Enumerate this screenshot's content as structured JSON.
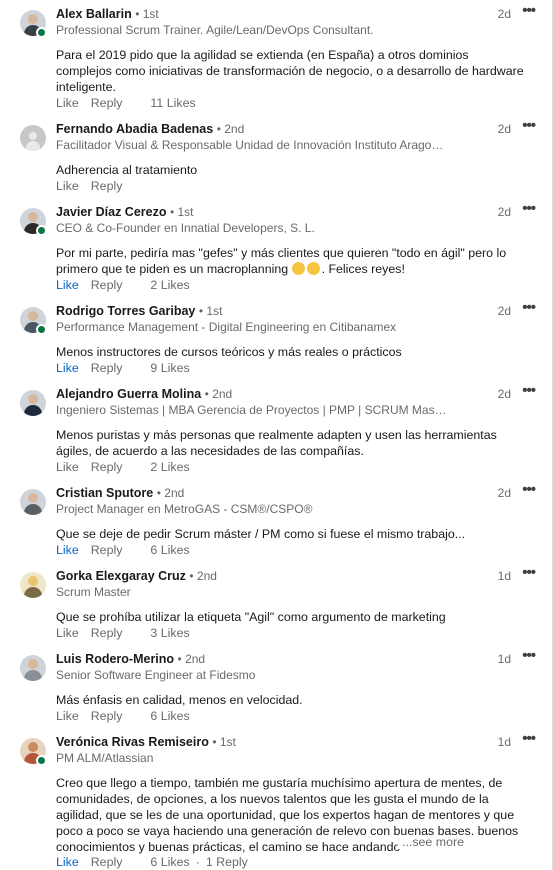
{
  "icons": {
    "more": "more-horizontal-icon",
    "avatar_placeholder": "person-icon",
    "emoji": "laughing-emoji-icon"
  },
  "colors": {
    "link_blue": "#0a66c2",
    "online_green": "#057642",
    "muted": "#666666"
  },
  "comments": [
    {
      "name": "Alex Ballarin",
      "degree": "• 1st",
      "headline": "Professional Scrum Trainer. Agile/Lean/DevOps Consultant.",
      "time": "2d",
      "text": "Para el 2019 pido que la agilidad se extienda (en España) a otros dominios complejos como iniciativas de transformación de negocio, o a desarrollo de hardware inteligente.",
      "like": "Like",
      "reply": "Reply",
      "likes": "11 Likes",
      "online": true,
      "liked": false
    },
    {
      "name": "Fernando Abadia Badenas",
      "degree": "• 2nd",
      "headline": "Facilitador Visual & Responsable Unidad de Innovación Instituto Aragonés de Ciencias de la Salud",
      "time": "2d",
      "text": "Adherencia al tratamiento",
      "like": "Like",
      "reply": "Reply",
      "likes": "",
      "online": false,
      "liked": false,
      "ghost": true
    },
    {
      "name": "Javier Díaz Cerezo",
      "degree": "• 1st",
      "headline": "CEO & Co-Founder en Innatial Developers, S. L.",
      "time": "2d",
      "text": "Por mi parte, pediría mas \"gefes\" y más clientes que quieren \"todo en ágil\" pero lo primero que te piden es un macroplanning",
      "text_tail": ". Felices reyes!",
      "like": "Like",
      "reply": "Reply",
      "likes": "2 Likes",
      "online": true,
      "liked": true
    },
    {
      "name": "Rodrigo Torres Garibay",
      "degree": "• 1st",
      "headline": "Performance Management - Digital Engineering en Citibanamex",
      "time": "2d",
      "text": "Menos instructores de cursos teóricos y más reales o prácticos",
      "like": "Like",
      "reply": "Reply",
      "likes": "9 Likes",
      "online": true,
      "liked": true
    },
    {
      "name": "Alejandro Guerra Molina",
      "degree": "• 2nd",
      "headline": "Ingeniero Sistemas | MBA Gerencia de Proyectos | PMP | SCRUM Master",
      "time": "2d",
      "text": "Menos puristas y más personas que realmente adapten y usen las herramientas ágiles, de acuerdo a las necesidades de las compañías.",
      "like": "Like",
      "reply": "Reply",
      "likes": "2 Likes",
      "online": false,
      "liked": false
    },
    {
      "name": "Cristian Sputore",
      "degree": "• 2nd",
      "headline": "Project Manager en MetroGAS - CSM®/CSPO®",
      "time": "2d",
      "text": "Que se deje de pedir Scrum máster / PM como si fuese el mismo trabajo...",
      "like": "Like",
      "reply": "Reply",
      "likes": "6 Likes",
      "online": false,
      "liked": true
    },
    {
      "name": "Gorka Elexgaray Cruz",
      "degree": "• 2nd",
      "headline": "Scrum Master",
      "time": "1d",
      "text": "Que se prohíba utilizar la etiqueta \"Agil\" como argumento de marketing",
      "like": "Like",
      "reply": "Reply",
      "likes": "3 Likes",
      "online": false,
      "liked": false
    },
    {
      "name": "Luis Rodero-Merino",
      "degree": "• 2nd",
      "headline": "Senior Software Engineer at Fidesmo",
      "time": "1d",
      "text": "Más énfasis en calidad, menos en velocidad.",
      "like": "Like",
      "reply": "Reply",
      "likes": "6 Likes",
      "online": false,
      "liked": false
    },
    {
      "name": "Verónica Rivas Remiseiro",
      "degree": "• 1st",
      "headline": "PM ALM/Atlassian",
      "time": "1d",
      "text": "Creo que llego a tiempo, también me gustaría muchísimo apertura de mentes, de comunidades, de opciones, a los nuevos talentos que les gusta el mundo de la agilidad, que se les de una oportunidad, que los expertos hagan de mentores y que poco a poco se vaya haciendo una generación de relevo con buenas bases, buenos conocimientos y buenas prácticas, el camino se hace andando",
      "see_more": "...see more",
      "like": "Like",
      "reply": "Reply",
      "likes": "6 Likes",
      "replies": "1 Reply",
      "online": true,
      "liked": true
    }
  ]
}
